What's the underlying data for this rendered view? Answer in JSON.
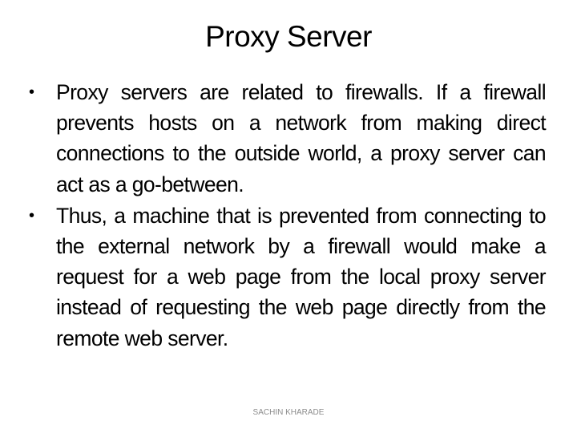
{
  "slide": {
    "title": "Proxy Server",
    "bullets": [
      {
        "marker": "•",
        "text": "Proxy servers are related to firewalls. If a firewall prevents hosts on a network from making direct connections to the outside world, a proxy server can act as a go-between."
      },
      {
        "marker": "•",
        "text": "Thus, a machine that is prevented from connecting to the external network by a firewall would make a request for a web page from the local proxy server instead of requesting the web page directly from the remote web server."
      }
    ],
    "footer": "SACHIN KHARADE"
  }
}
